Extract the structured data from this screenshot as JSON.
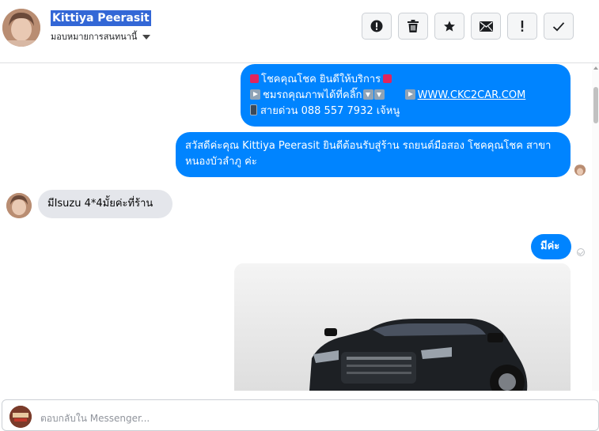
{
  "contact": {
    "name": "Kittiya Peerasit",
    "assign_label": "มอบหมายการสนทนานี้"
  },
  "toolbar": {
    "buttons": [
      {
        "icon": "report-icon",
        "label": "!"
      },
      {
        "icon": "trash-icon"
      },
      {
        "icon": "star-icon"
      },
      {
        "icon": "envelope-icon"
      },
      {
        "icon": "exclamation-icon",
        "label": "!"
      },
      {
        "icon": "checkmark-icon"
      }
    ]
  },
  "messages": {
    "m1_line1": "โชคคุณโชค ยินดีให้บริการ",
    "m1_line2": "ชมรถคุณภาพได้ที่คลิ๊ก",
    "m1_link": "WWW.CKC2CAR.COM",
    "m1_line3": "สายด่วน 088 557 7932 เจ้หนู",
    "m2": "สวัสดีค่ะคุณ Kittiya Peerasit ยินดีต้อนรับสู่ร้าน รถยนต์มือสอง โชคคุณโชค สาขาหนองบัวลำภู ค่ะ",
    "m3": "มีIsuzu 4*4มั้ยค่ะที่ร้าน",
    "m4": "มีค่ะ"
  },
  "reply": {
    "placeholder": "ตอบกลับใน Messenger..."
  },
  "colors": {
    "outgoing_bubble": "#0084ff",
    "incoming_bubble": "#e4e6eb",
    "name_highlight": "#3367d6"
  }
}
